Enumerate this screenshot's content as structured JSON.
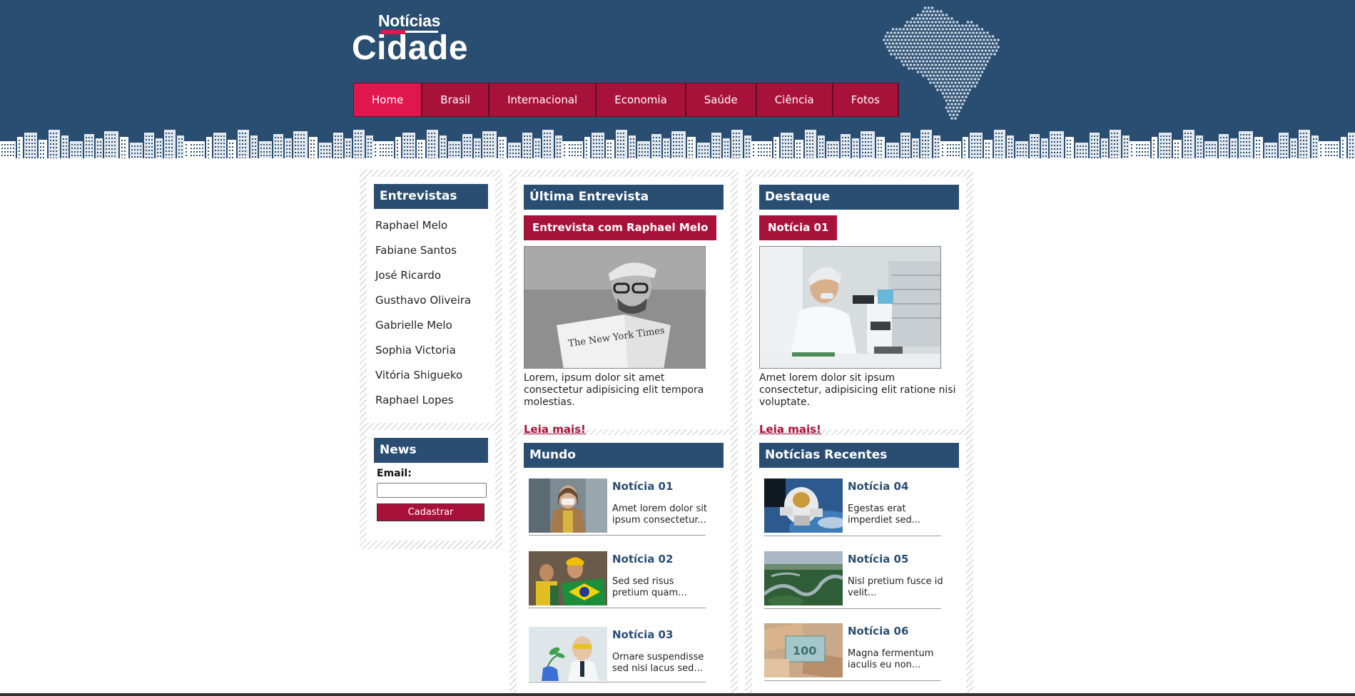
{
  "logo": {
    "top": "Notícias",
    "main": "Cidade"
  },
  "colors": {
    "header_bg": "#2a4e72",
    "nav_bg": "#a8123a",
    "nav_active": "#e0174f",
    "accent": "#a8123a"
  },
  "nav": [
    {
      "label": "Home",
      "active": true
    },
    {
      "label": "Brasil"
    },
    {
      "label": "Internacional"
    },
    {
      "label": "Economia"
    },
    {
      "label": "Saúde"
    },
    {
      "label": "Ciência"
    },
    {
      "label": "Fotos"
    }
  ],
  "entrevistas": {
    "title": "Entrevistas",
    "items": [
      "Raphael Melo",
      "Fabiane Santos",
      "José Ricardo",
      "Gusthavo Oliveira",
      "Gabrielle Melo",
      "Sophia Victoria",
      "Vitória Shigueko",
      "Raphael Lopes"
    ]
  },
  "newsletter": {
    "title": "News",
    "email_label": "Email:",
    "email_value": "",
    "button": "Cadastrar"
  },
  "ultima": {
    "title": "Última Entrevista",
    "badge": "Entrevista com Raphael Melo",
    "image": "man-reading-newspaper-photo",
    "text": "Lorem, ipsum dolor sit amet consectetur adipisicing elit tempora molestias.",
    "link": "Leia mais!"
  },
  "destaque": {
    "title": "Destaque",
    "badge": "Notícia 01",
    "image": "scientist-microscope-photo",
    "text": "Amet lorem dolor sit ipsum consectetur, adipisicing elit ratione nisi voluptate.",
    "link": "Leia mais!"
  },
  "mundo": {
    "title": "Mundo",
    "items": [
      {
        "title": "Notícia 01",
        "text": "Amet lorem dolor sit ipsum consectetur...",
        "image": "woman-mask-photo"
      },
      {
        "title": "Notícia 02",
        "text": "Sed sed risus pretium quam...",
        "image": "fans-brazil-flag-photo"
      },
      {
        "title": "Notícia 03",
        "text": "Ornare suspendisse sed nisi lacus sed...",
        "image": "scientist-plant-photo"
      }
    ]
  },
  "recentes": {
    "title": "Notícias Recentes",
    "items": [
      {
        "title": "Notícia 04",
        "text": "Egestas erat imperdiet sed...",
        "image": "astronaut-photo"
      },
      {
        "title": "Notícia 05",
        "text": "Nisl pretium fusce id velit...",
        "image": "river-forest-photo"
      },
      {
        "title": "Notícia 06",
        "text": "Magna fermentum iaculis eu non...",
        "image": "banknotes-photo"
      }
    ]
  }
}
